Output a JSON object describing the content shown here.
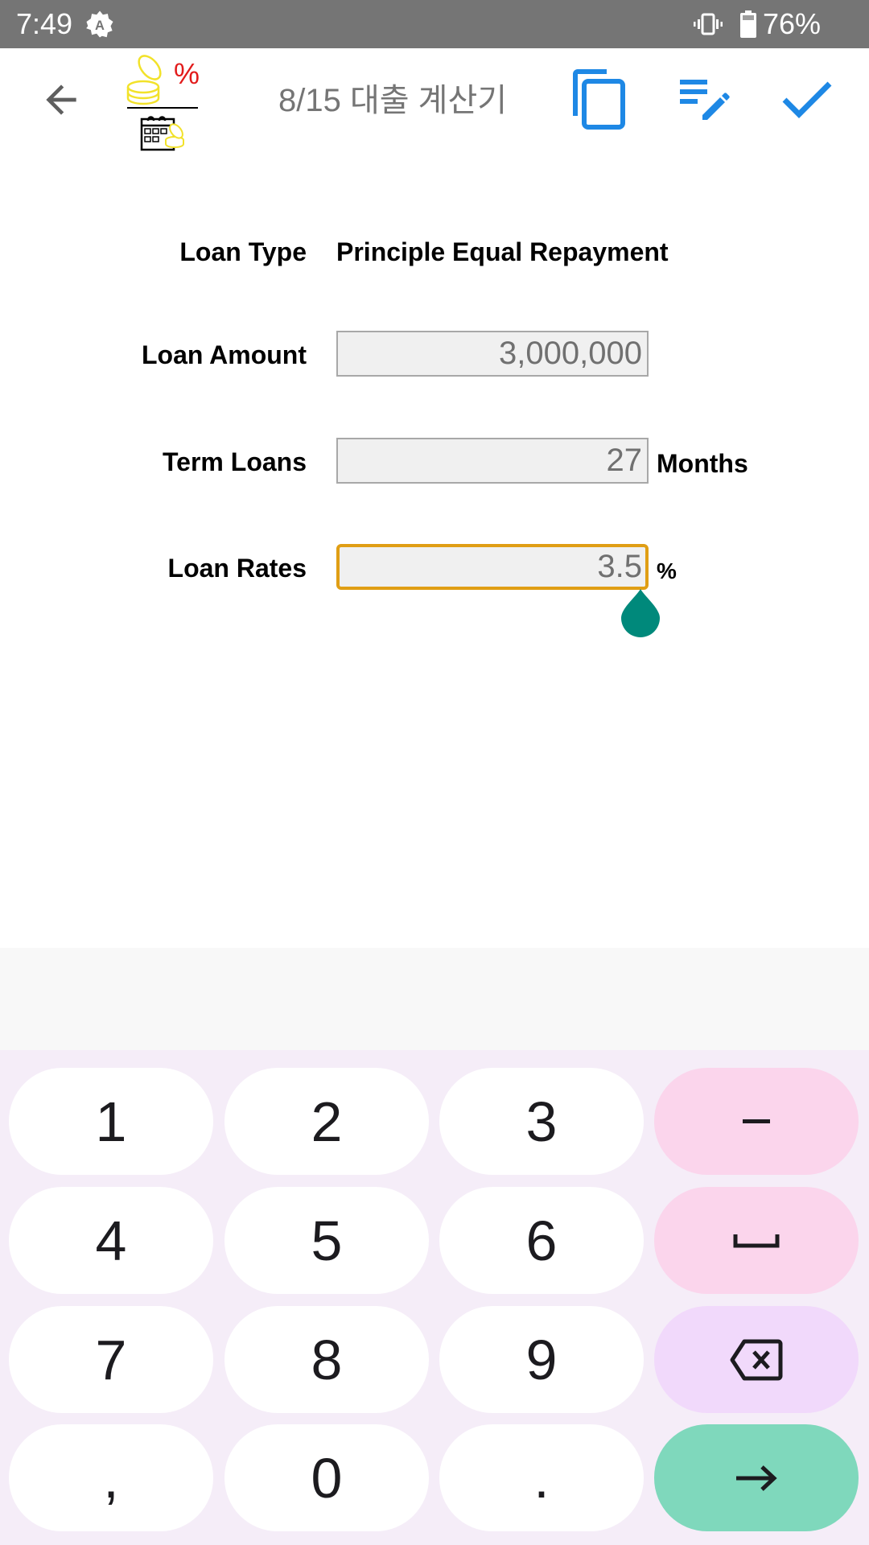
{
  "status_bar": {
    "time": "7:49",
    "battery_percent": "76%",
    "icons": [
      "auto-brightness-icon",
      "vibrate-icon",
      "battery-icon"
    ]
  },
  "toolbar": {
    "back_icon": "arrow-left-icon",
    "logo": "loan-calculator-logo",
    "title": "8/15 대출 계산기",
    "actions": [
      {
        "name": "copy",
        "icon": "copy-icon"
      },
      {
        "name": "edit",
        "icon": "edit-list-icon"
      },
      {
        "name": "confirm",
        "icon": "check-icon"
      }
    ],
    "accent_color": "#1E88E5"
  },
  "form": {
    "loan_type": {
      "label": "Loan Type",
      "value": "Principle Equal Repayment"
    },
    "loan_amount": {
      "label": "Loan Amount",
      "value": "3,000,000"
    },
    "term": {
      "label": "Term Loans",
      "value": "27",
      "unit": "Months"
    },
    "rate": {
      "label": "Loan Rates",
      "value": "3.5",
      "unit": "%",
      "focused": true
    },
    "focus_color": "#E09E14",
    "handle_color": "#00897B"
  },
  "keyboard": {
    "rows": [
      [
        {
          "label": "1"
        },
        {
          "label": "2"
        },
        {
          "label": "3"
        },
        {
          "label": "–",
          "type": "minus"
        }
      ],
      [
        {
          "label": "4"
        },
        {
          "label": "5"
        },
        {
          "label": "6"
        },
        {
          "label": "␣",
          "type": "space"
        }
      ],
      [
        {
          "label": "7"
        },
        {
          "label": "8"
        },
        {
          "label": "9"
        },
        {
          "label": "⌫",
          "type": "backspace"
        }
      ],
      [
        {
          "label": ","
        },
        {
          "label": "0"
        },
        {
          "label": "."
        },
        {
          "label": "→",
          "type": "next"
        }
      ]
    ],
    "colors": {
      "minus": "#FBD5EC",
      "space": "#FBD5EC",
      "backspace": "#F1D9FB",
      "next": "#7FD8BC"
    }
  }
}
